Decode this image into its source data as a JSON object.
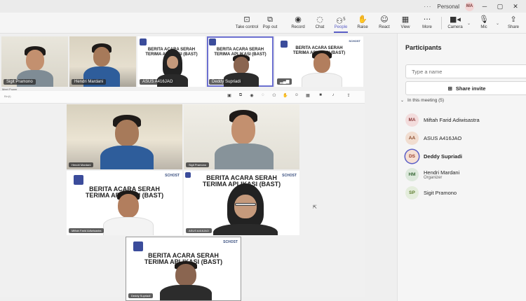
{
  "titlebar": {
    "profile_label": "Personal",
    "avatar_initials": "MA",
    "more_glyph": "···",
    "minimize_glyph": "─",
    "maximize_glyph": "▢"
  },
  "toolbar": {
    "take_control": "Take control",
    "pop_out": "Pop out",
    "record": "Record",
    "chat": "Chat",
    "people": "People",
    "people_count": "5",
    "raise": "Raise",
    "react": "React",
    "view": "View",
    "more": "More",
    "camera": "Camera",
    "mic": "Mic",
    "share": "Share"
  },
  "strip_tiles": [
    {
      "name": "Sigit Pramono"
    },
    {
      "name": "Hendri Mardani"
    },
    {
      "name": "ASUS A416JAO"
    },
    {
      "name": "Deddy Supriadi"
    },
    {
      "name": ""
    }
  ],
  "slide": {
    "line1": "BERITA ACARA SERAH",
    "line2": "TERIMA APLIKASI (BAST)",
    "brand": "SCHOST"
  },
  "inner_window": {
    "title": "Meet Power",
    "search_placeholder": "Bin(t)",
    "tile_names": [
      "Hendri Mardani",
      "Sigit Pramono",
      "Miftah Farid Adiwisastra",
      "ASUS A416JAO",
      "Deddy Supriadi"
    ]
  },
  "panel": {
    "title": "Participants",
    "search_placeholder": "Type a name",
    "share_invite": "Share invite",
    "section_label": "In this meeting (5)",
    "participants": [
      {
        "initials": "MA",
        "name": "Miftah Farid Adiwisastra",
        "role": "",
        "bg": "#f3dcdc",
        "fg": "#8b3a3a"
      },
      {
        "initials": "AA",
        "name": "ASUS A416JAO",
        "role": "",
        "bg": "#f1ddd0",
        "fg": "#8a4a2a"
      },
      {
        "initials": "DS",
        "name": "Deddy Supriadi",
        "role": "",
        "bg": "#f6e0d4",
        "fg": "#9a3d2a"
      },
      {
        "initials": "HM",
        "name": "Hendri Mardani",
        "role": "Organizer",
        "bg": "#dde9dc",
        "fg": "#3a6a3a"
      },
      {
        "initials": "SP",
        "name": "Sigit Pramono",
        "role": "",
        "bg": "#e4eddc",
        "fg": "#5a7a2a"
      }
    ]
  },
  "colors": {
    "accent": "#5b5fc7",
    "panel_bg": "#f5f5f5"
  }
}
